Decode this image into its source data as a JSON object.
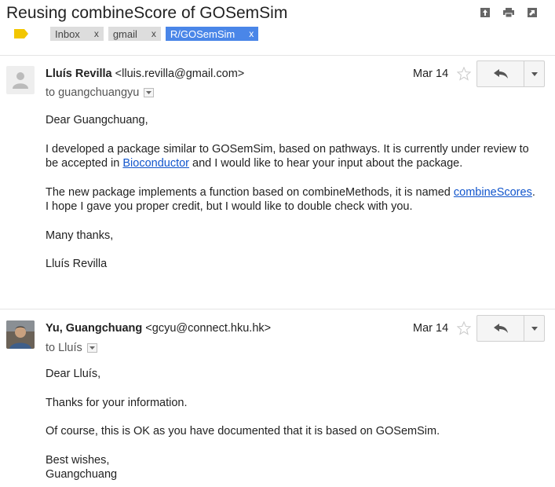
{
  "thread": {
    "subject": "Reusing combineScore of GOSemSim",
    "labels": [
      {
        "text": "Inbox",
        "close": "x"
      },
      {
        "text": "gmail",
        "close": "x"
      },
      {
        "text": "R/GOSemSim",
        "close": "x"
      }
    ],
    "icons": [
      "archive-icon",
      "print-icon",
      "new-window-icon"
    ]
  },
  "messages": [
    {
      "sender_name": "Lluís Revilla",
      "sender_email": "<lluis.revilla@gmail.com>",
      "to": "to guangchuangyu",
      "date": "Mar 14",
      "body": {
        "greeting": "Dear Guangchuang,",
        "p1_a": "I developed a package similar to GOSemSim, based on pathways. It is currently under review to be accepted in ",
        "p1_link": "Bioconductor",
        "p1_b": " and I would like to hear your input about the package.",
        "p2_a": "The new package implements a function based on combineMethods, it is named ",
        "p2_link": "combineScores",
        "p2_b": ". I hope I gave you proper credit, but I would like to double check with you.",
        "thanks": "Many thanks,",
        "signature": "Lluís Revilla"
      }
    },
    {
      "sender_name": "Yu, Guangchuang",
      "sender_email": "<gcyu@connect.hku.hk>",
      "to": "to Lluís",
      "date": "Mar 14",
      "body": {
        "greeting": "Dear Lluís,",
        "p1": "Thanks for your information.",
        "p2": "Of course, this is OK as you have documented that it is based on GOSemSim.",
        "closing1": "Best wishes,",
        "closing2": "Guangchuang"
      }
    }
  ],
  "colors": {
    "accent_label": "#4a86e8",
    "link": "#1155cc",
    "importance": "#f2c600"
  }
}
